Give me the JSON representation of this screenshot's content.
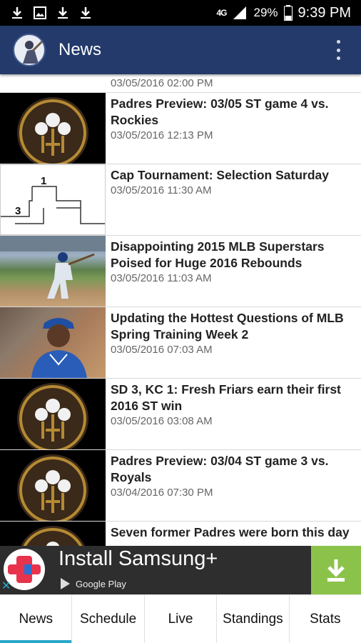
{
  "status_bar": {
    "network": "4G",
    "battery": "29%",
    "time": "9:39 PM",
    "icons": [
      "download-icon",
      "image-icon",
      "download-icon",
      "download-icon"
    ]
  },
  "app_bar": {
    "title": "News",
    "menu_icon": "more-vert-icon"
  },
  "news": {
    "partial_date": "03/05/2016 02:00 PM",
    "items": [
      {
        "title": "Padres Preview: 03/05 ST game 4 vs. Rockies",
        "date": "03/05/2016 12:13 PM",
        "thumb": "padres-logo"
      },
      {
        "title": "Cap Tournament: Selection Saturday",
        "date": "03/05/2016 11:30 AM",
        "thumb": "bracket",
        "bracket_numbers": [
          "1",
          "3"
        ]
      },
      {
        "title": "Disappointing 2015 MLB Superstars Poised for Huge 2016 Rebounds",
        "date": "03/05/2016 11:03 AM",
        "thumb": "batter-photo"
      },
      {
        "title": "Updating the Hottest Questions of MLB Spring Training Week 2",
        "date": "03/05/2016 07:03 AM",
        "thumb": "pitcher-photo"
      },
      {
        "title": "SD 3, KC 1: Fresh Friars earn their first 2016 ST win",
        "date": "03/05/2016 03:08 AM",
        "thumb": "padres-logo"
      },
      {
        "title": "Padres Preview: 03/04 ST game 3 vs. Royals",
        "date": "03/04/2016 07:30 PM",
        "thumb": "padres-logo"
      },
      {
        "title": "Seven former Padres were born this day",
        "date": "",
        "thumb": "padres-logo"
      }
    ]
  },
  "ad": {
    "title": "Install Samsung+",
    "store": "Google Play",
    "accent": "#8bc34a"
  },
  "tabs": [
    {
      "label": "News",
      "active": true
    },
    {
      "label": "Schedule",
      "active": false
    },
    {
      "label": "Live",
      "active": false
    },
    {
      "label": "Standings",
      "active": false
    },
    {
      "label": "Stats",
      "active": false
    }
  ],
  "colors": {
    "app_bar": "#233a6b",
    "tab_indicator": "#2aa8c9",
    "padres_gold": "#b58a33",
    "padres_brown": "#3b2a1a"
  }
}
